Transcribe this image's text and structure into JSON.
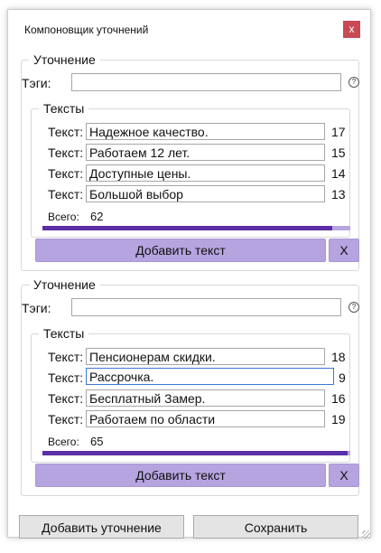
{
  "window": {
    "title": "Компоновщик уточнений",
    "close_label": "x"
  },
  "refinements": [
    {
      "legend": "Уточнение",
      "tags_label": "Тэги:",
      "tags_value": "",
      "texts_legend": "Тексты",
      "rows": [
        {
          "label": "Текст:",
          "value": "Надежное качество.",
          "count": "17"
        },
        {
          "label": "Текст:",
          "value": "Работаем 12 лет.",
          "count": "15"
        },
        {
          "label": "Текст:",
          "value": "Доступные цены.",
          "count": "14"
        },
        {
          "label": "Текст:",
          "value": "Большой выбор",
          "count": "13"
        }
      ],
      "total_label": "Всего:",
      "total_value": "62",
      "progress_fraction": 0.94,
      "add_text_label": "Добавить текст",
      "remove_label": "X"
    },
    {
      "legend": "Уточнение",
      "tags_label": "Тэги:",
      "tags_value": "",
      "texts_legend": "Тексты",
      "rows": [
        {
          "label": "Текст:",
          "value": "Пенсионерам скидки.",
          "count": "18"
        },
        {
          "label": "Текст:",
          "value": "Рассрочка.",
          "count": "9"
        },
        {
          "label": "Текст:",
          "value": "Бесплатный Замер.",
          "count": "16"
        },
        {
          "label": "Текст:",
          "value": "Работаем по области",
          "count": "19"
        }
      ],
      "total_label": "Всего:",
      "total_value": "65",
      "progress_fraction": 0.99,
      "add_text_label": "Добавить текст",
      "remove_label": "X"
    }
  ],
  "footer": {
    "add_refinement_label": "Добавить уточнение",
    "save_label": "Сохранить"
  },
  "colors": {
    "accent_button": "#b6a4e0",
    "progress_fill": "#5b2fa6",
    "close_button": "#c84a55"
  }
}
